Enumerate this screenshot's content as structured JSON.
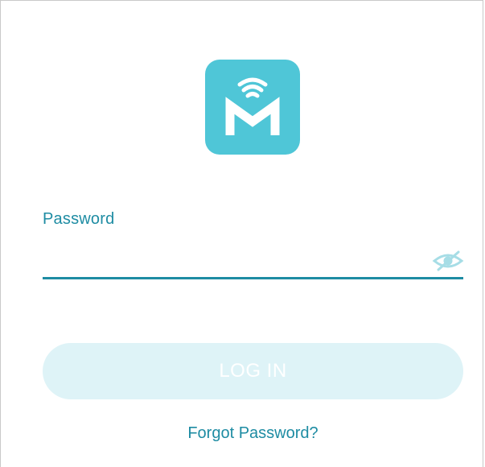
{
  "logo": {
    "letter": "M",
    "icon": "wifi-m-logo-icon",
    "color": "#4fc6d7"
  },
  "password": {
    "label": "Password",
    "value": "",
    "placeholder": "",
    "toggle_icon": "eye-hidden-icon"
  },
  "login_button": {
    "label": "LOG IN",
    "state": "disabled"
  },
  "forgot_link": {
    "label": "Forgot Password?"
  },
  "colors": {
    "accent": "#1e8ca3",
    "logo_bg": "#4fc6d7",
    "button_disabled_bg": "#def3f7",
    "eye_icon": "#a6dde6"
  }
}
